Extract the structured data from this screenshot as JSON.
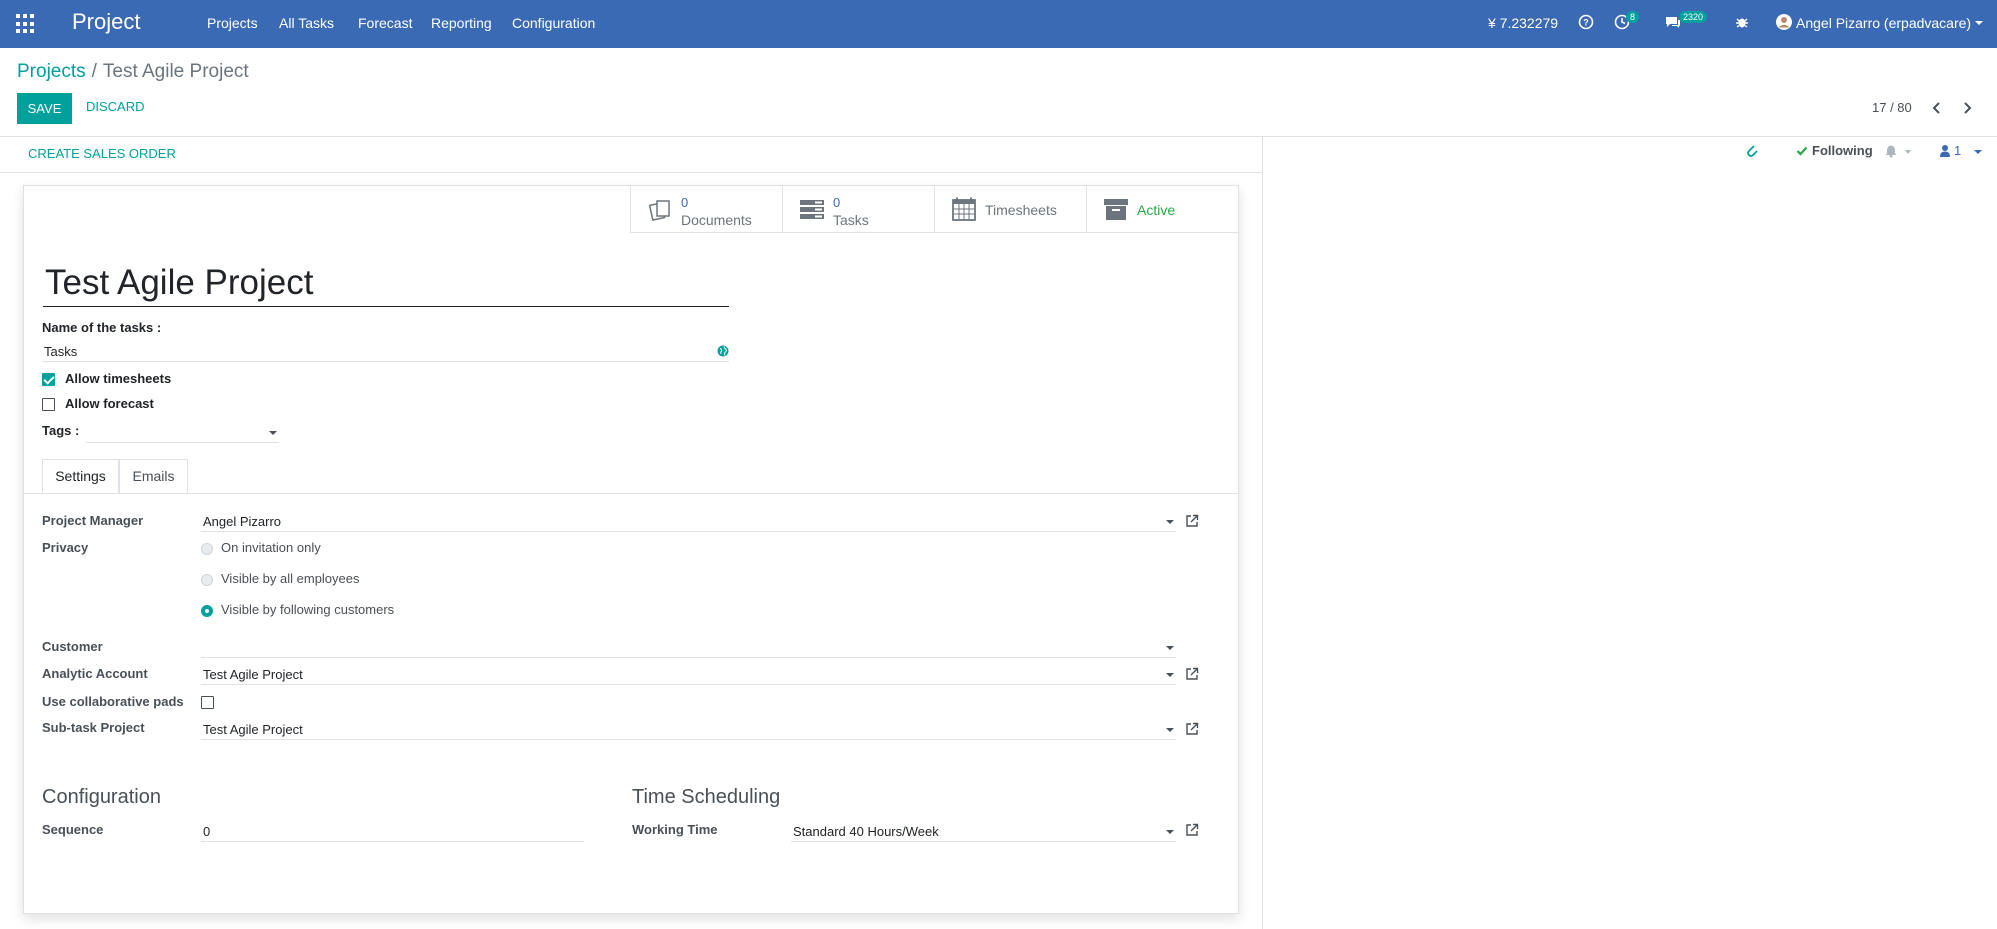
{
  "navbar": {
    "brand": "Project",
    "menu": [
      "Projects",
      "All Tasks",
      "Forecast",
      "Reporting",
      "Configuration"
    ],
    "currency_value": "¥ 7.232279",
    "activity_count": "8",
    "messages_count": "2320",
    "user_name": "Angel Pizarro (erpadvacare)"
  },
  "breadcrumb": {
    "parent": "Projects",
    "separator": "/",
    "current": "Test Agile Project"
  },
  "actions": {
    "save": "SAVE",
    "discard": "DISCARD"
  },
  "pager": {
    "label": "17 / 80"
  },
  "statusbar": {
    "create_sales_order": "CREATE SALES ORDER"
  },
  "chatter": {
    "following_label": "Following",
    "followers_count": "1"
  },
  "stat_buttons": {
    "documents": {
      "value": "0",
      "label": "Documents",
      "icon": "documents-icon"
    },
    "tasks": {
      "value": "0",
      "label": "Tasks",
      "icon": "tasks-icon"
    },
    "timesheets": {
      "label": "Timesheets",
      "icon": "calendar-icon"
    },
    "active": {
      "label": "Active",
      "icon": "archive-icon"
    }
  },
  "form": {
    "title": "Test Agile Project",
    "name_of_tasks_label": "Name of the tasks :",
    "name_of_tasks_value": "Tasks",
    "allow_timesheets_label": "Allow timesheets",
    "allow_timesheets": true,
    "allow_forecast_label": "Allow forecast",
    "allow_forecast": false,
    "tags_label": "Tags :"
  },
  "tabs": [
    "Settings",
    "Emails"
  ],
  "settings": {
    "project_manager_label": "Project Manager",
    "project_manager_value": "Angel Pizarro",
    "privacy_label": "Privacy",
    "privacy_options": [
      "On invitation only",
      "Visible by all employees",
      "Visible by following customers"
    ],
    "privacy_selected": "Visible by following customers",
    "customer_label": "Customer",
    "customer_value": "",
    "analytic_account_label": "Analytic Account",
    "analytic_account_value": "Test Agile Project",
    "collab_pads_label": "Use collaborative pads",
    "collab_pads": false,
    "subtask_project_label": "Sub-task Project",
    "subtask_project_value": "Test Agile Project"
  },
  "configuration": {
    "title": "Configuration",
    "sequence_label": "Sequence",
    "sequence_value": "0"
  },
  "time_scheduling": {
    "title": "Time Scheduling",
    "working_time_label": "Working Time",
    "working_time_value": "Standard 40 Hours/Week"
  },
  "colors": {
    "navbar": "#3a6ab4",
    "accent": "#00a09d",
    "active_green": "#28a745"
  }
}
